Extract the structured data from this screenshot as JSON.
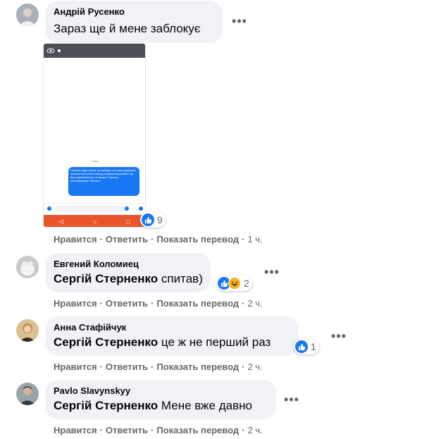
{
  "comments": [
    {
      "author": "Андрій Русенко",
      "text": "Зараз ще й мене заблокує",
      "reactions": null,
      "actions": {
        "like": "Нравится",
        "reply": "Ответить",
        "translate": "Показать перевод",
        "time": "1 ч."
      }
    },
    {
      "author": "Евгений Коломиец",
      "mention": "Сергій Стерненко",
      "text": " спитав)",
      "reaction_count": "2",
      "actions": {
        "like": "Нравится",
        "reply": "Ответить",
        "translate": "Показать перевод",
        "time": "2 ч."
      }
    },
    {
      "author": "Анна Стафійчук",
      "mention": "Сергій Стерненко",
      "text": " це ж не перший раз",
      "reaction_count": "1",
      "actions": {
        "like": "Нравится",
        "reply": "Ответить",
        "translate": "Показать перевод",
        "time": "2 ч."
      }
    },
    {
      "author": "Pavlo Slavynskyy",
      "mention": "Сергій Стерненко",
      "text": " Мене вже давно",
      "actions": {
        "like": "Нравится",
        "reply": "Ответить",
        "translate": "Показать перевод",
        "time": "2 ч."
      }
    }
  ],
  "image_reaction_count": "9",
  "screenshot_message": "Скажіть будь-ласка, це правда, що ваша дружина поїхала виступати перед нашими ворогами? Це було добровільно, чи може її чимось шантажували? Як вас?",
  "screenshot_input_placeholder": "Aa",
  "dots": "•••",
  "colors": {
    "accent": "#1877f2",
    "bubble": "#f0f2f5",
    "meta": "#65676b",
    "haha": "#f7b125"
  }
}
